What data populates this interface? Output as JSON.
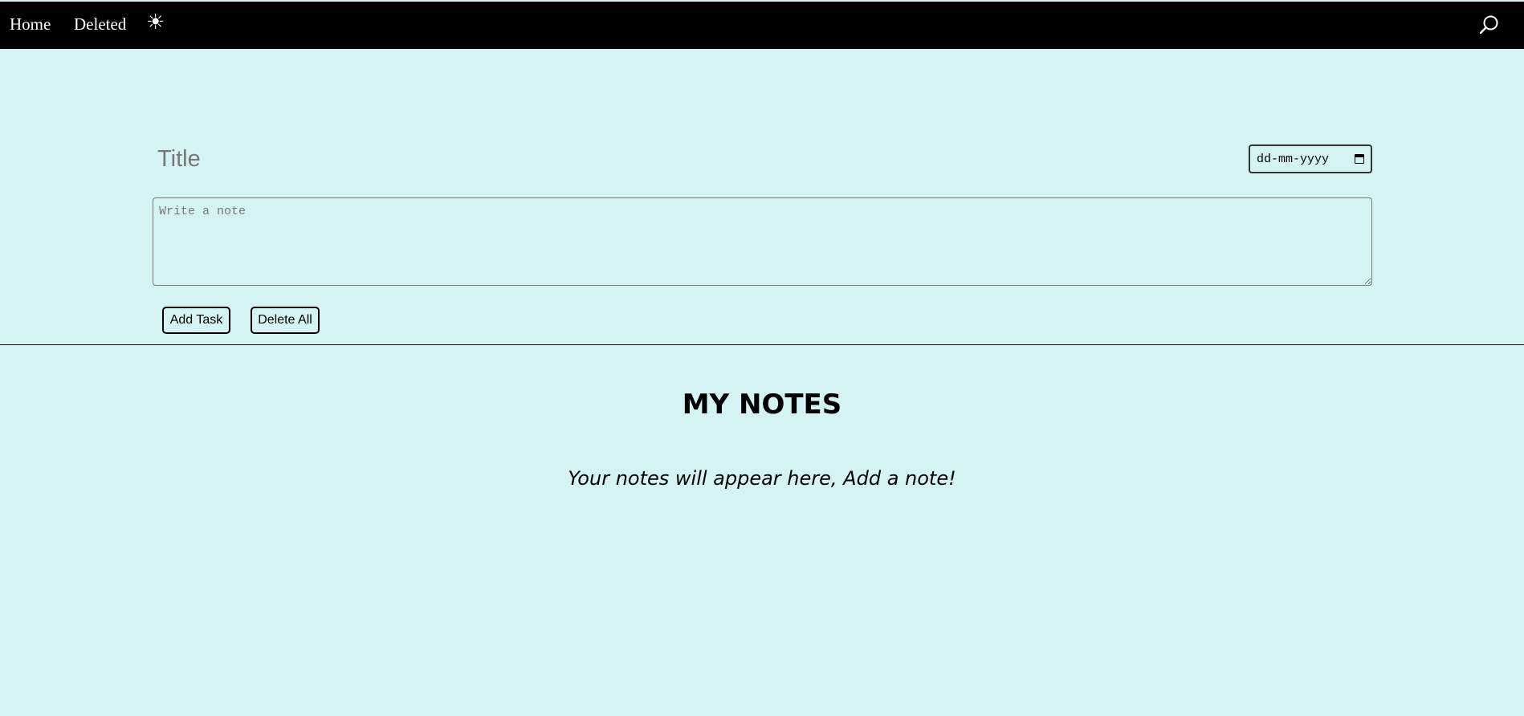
{
  "nav": {
    "home_label": "Home",
    "deleted_label": "Deleted",
    "theme_toggle_glyph": "☀",
    "theme_toggle_icon": "sun-icon",
    "search_icon": "search-icon"
  },
  "form": {
    "title_placeholder": "Title",
    "title_value": "",
    "date_placeholder": "dd-mm-yyyy",
    "note_placeholder": "Write a note",
    "note_value": "",
    "add_button": "Add Task",
    "delete_all_button": "Delete All"
  },
  "notes": {
    "heading": "MY NOTES",
    "empty_message": "Your notes will appear here, Add a note!"
  },
  "colors": {
    "page_background": "#d5f3f4",
    "navbar_background": "#000000",
    "navbar_text": "#ffffff"
  }
}
